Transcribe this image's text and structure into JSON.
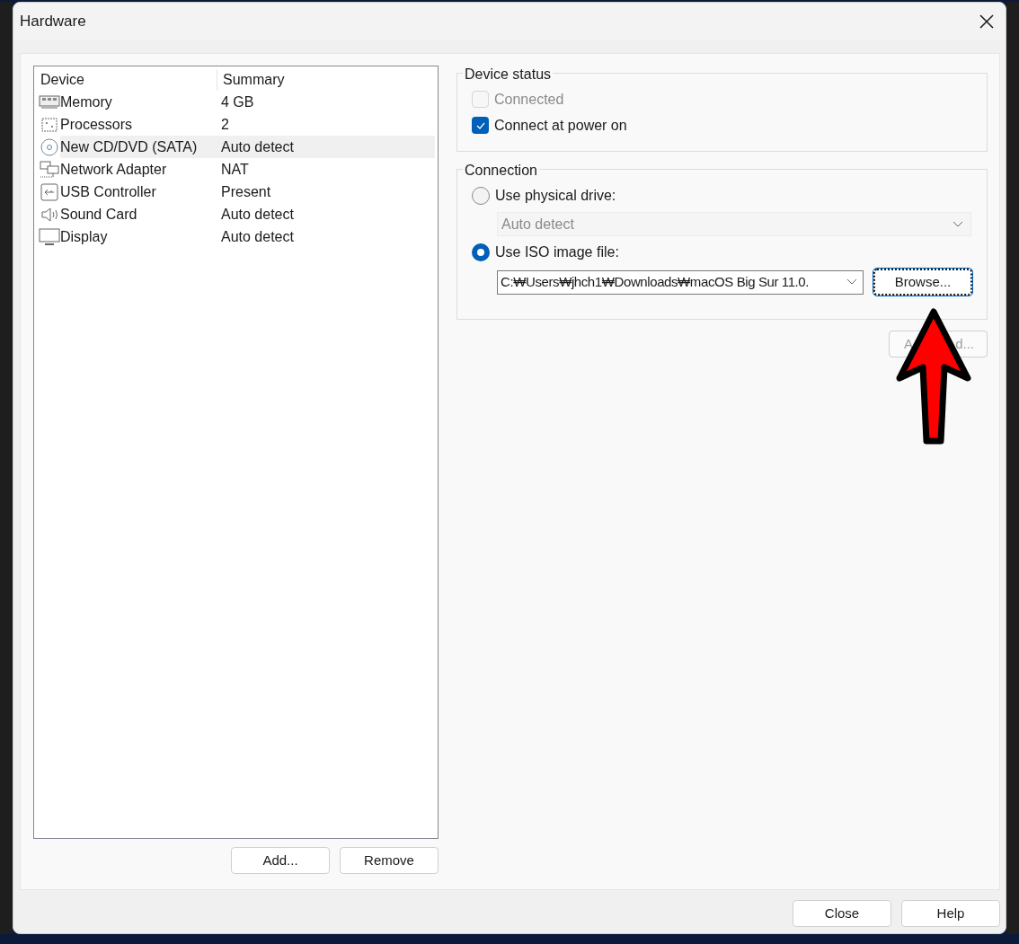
{
  "window": {
    "title": "Hardware"
  },
  "device_list": {
    "columns": [
      "Device",
      "Summary"
    ],
    "rows": [
      {
        "kind": "memory",
        "device": "Memory",
        "summary": "4 GB",
        "selected": false
      },
      {
        "kind": "processor",
        "device": "Processors",
        "summary": "2",
        "selected": false
      },
      {
        "kind": "disc",
        "device": "New CD/DVD (SATA)",
        "summary": "Auto detect",
        "selected": true
      },
      {
        "kind": "network",
        "device": "Network Adapter",
        "summary": "NAT",
        "selected": false
      },
      {
        "kind": "usb",
        "device": "USB Controller",
        "summary": "Present",
        "selected": false
      },
      {
        "kind": "sound",
        "device": "Sound Card",
        "summary": "Auto detect",
        "selected": false
      },
      {
        "kind": "display",
        "device": "Display",
        "summary": "Auto detect",
        "selected": false
      }
    ]
  },
  "list_buttons": [
    "Add...",
    "Remove"
  ],
  "device_status": {
    "title": "Device status",
    "options": [
      {
        "label": "Connected",
        "checked": false,
        "disabled": true
      },
      {
        "label": "Connect at power on",
        "checked": true,
        "disabled": false
      }
    ]
  },
  "connection": {
    "title": "Connection",
    "physical": {
      "label": "Use physical drive:",
      "selected": false,
      "dropdown": {
        "value": "Auto detect",
        "disabled": true
      }
    },
    "iso": {
      "label": "Use ISO image file:",
      "selected": true,
      "path": "C:₩Users₩jhch1₩Downloads₩macOS Big Sur 11.0.",
      "browse": "Browse..."
    }
  },
  "advanced_button": {
    "visible_parts": [
      "A",
      "d..."
    ],
    "disabled": true
  },
  "footer_buttons": [
    "Close",
    "Help"
  ]
}
